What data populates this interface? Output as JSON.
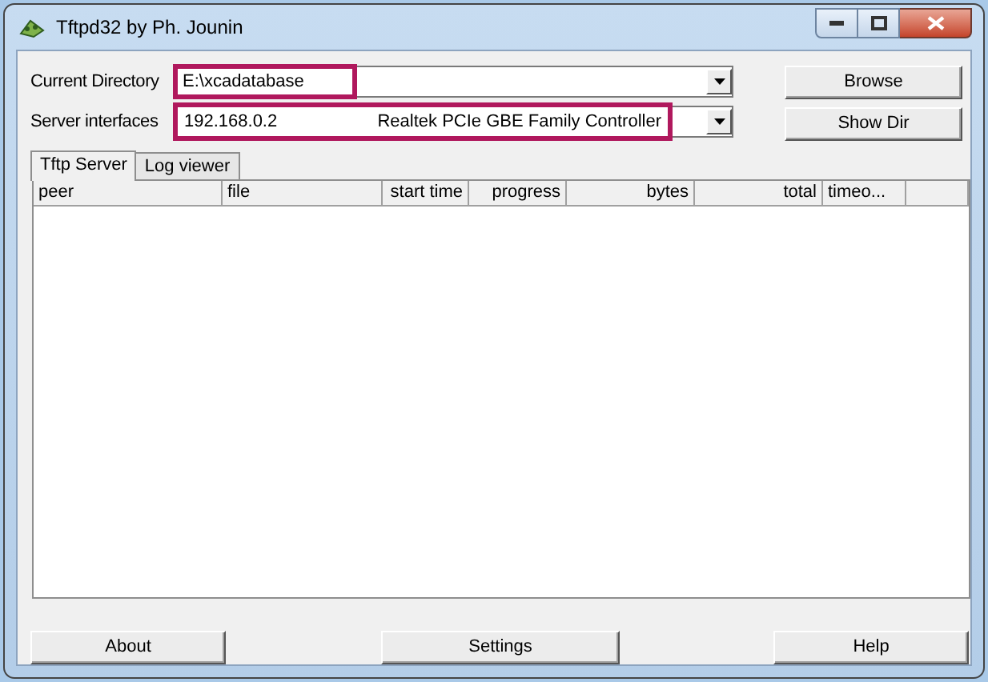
{
  "window": {
    "title": "Tftpd32 by Ph. Jounin"
  },
  "current_directory": {
    "label": "Current Directory",
    "value": "E:\\xcadatabase"
  },
  "server_interfaces": {
    "label": "Server interfaces",
    "address": "192.168.0.2",
    "adapter": "Realtek PCIe GBE Family Controller"
  },
  "side_buttons": [
    "Browse",
    "Show Dir"
  ],
  "tabs": [
    {
      "label": "Tftp Server",
      "selected": true
    },
    {
      "label": "Log viewer",
      "selected": false
    }
  ],
  "table": {
    "columns": [
      "peer",
      "file",
      "start time",
      "progress",
      "bytes",
      "total",
      "timeo..."
    ]
  },
  "bottom_buttons": [
    "About",
    "Settings",
    "Help"
  ]
}
